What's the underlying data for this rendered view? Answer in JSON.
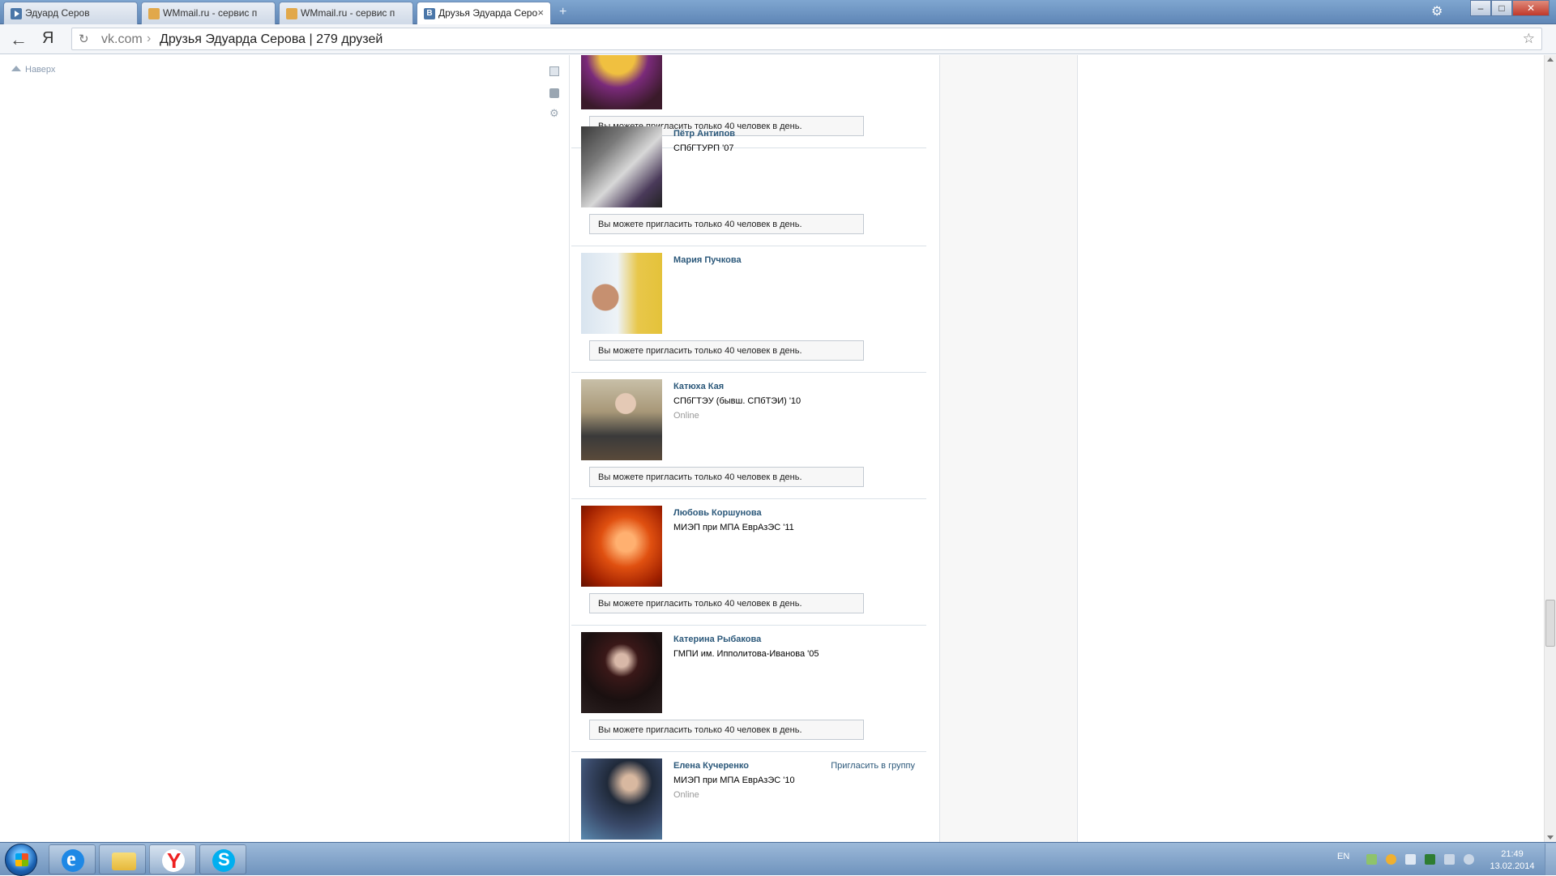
{
  "browser": {
    "tabs": [
      {
        "title": "Эдуард Серов",
        "icon": "play-icon",
        "active": false
      },
      {
        "title": "WMmail.ru - сервис п",
        "icon": "wmmail-icon",
        "active": false
      },
      {
        "title": "WMmail.ru - сервис п",
        "icon": "wmmail-icon",
        "active": false
      },
      {
        "title": "Друзья Эдуарда Серо",
        "icon": "vk-icon",
        "active": true
      }
    ],
    "new_tab_glyph": "+",
    "close_glyph": "×",
    "address": {
      "domain": "vk.com",
      "separator": "›",
      "page_title": "Друзья Эдуарда Серова | 279 друзей"
    },
    "nav": {
      "back_glyph": "←",
      "yandex_glyph": "Я"
    }
  },
  "page": {
    "scroll_top_label": "Наверх",
    "friends": [
      {
        "name": "",
        "university": "",
        "online": "",
        "invite_note": "Вы можете пригласить только 40 человек в день.",
        "invite_link": ""
      },
      {
        "name": "Пётр Антипов",
        "university": "СПбГТУРП '07",
        "online": "",
        "invite_note": "Вы можете пригласить только 40 человек в день.",
        "invite_link": ""
      },
      {
        "name": "Мария Пучкова",
        "university": "",
        "online": "",
        "invite_note": "Вы можете пригласить только 40 человек в день.",
        "invite_link": ""
      },
      {
        "name": "Катюха Кая",
        "university": "СПбГТЭУ (бывш. СПбТЭИ) '10",
        "online": "Online",
        "invite_note": "Вы можете пригласить только 40 человек в день.",
        "invite_link": ""
      },
      {
        "name": "Любовь Коршунова",
        "university": "МИЭП при МПА ЕврАзЭС '11",
        "online": "",
        "invite_note": "Вы можете пригласить только 40 человек в день.",
        "invite_link": ""
      },
      {
        "name": "Катерина Рыбакова",
        "university": "ГМПИ им. Ипполитова-Иванова '05",
        "online": "",
        "invite_note": "Вы можете пригласить только 40 человек в день.",
        "invite_link": ""
      },
      {
        "name": "Елена Кучеренко",
        "university": "МИЭП при МПА ЕврАзЭС '10",
        "online": "Online",
        "invite_note": "",
        "invite_link": "Пригласить в группу"
      }
    ]
  },
  "taskbar": {
    "apps": [
      "internet-explorer-icon",
      "folder-icon",
      "yandex-browser-icon",
      "skype-icon"
    ],
    "language": "EN",
    "time": "21:49",
    "date": "13.02.2014"
  },
  "colors": {
    "link": "#2b587a",
    "muted": "#999999",
    "border": "#dae1e8"
  }
}
